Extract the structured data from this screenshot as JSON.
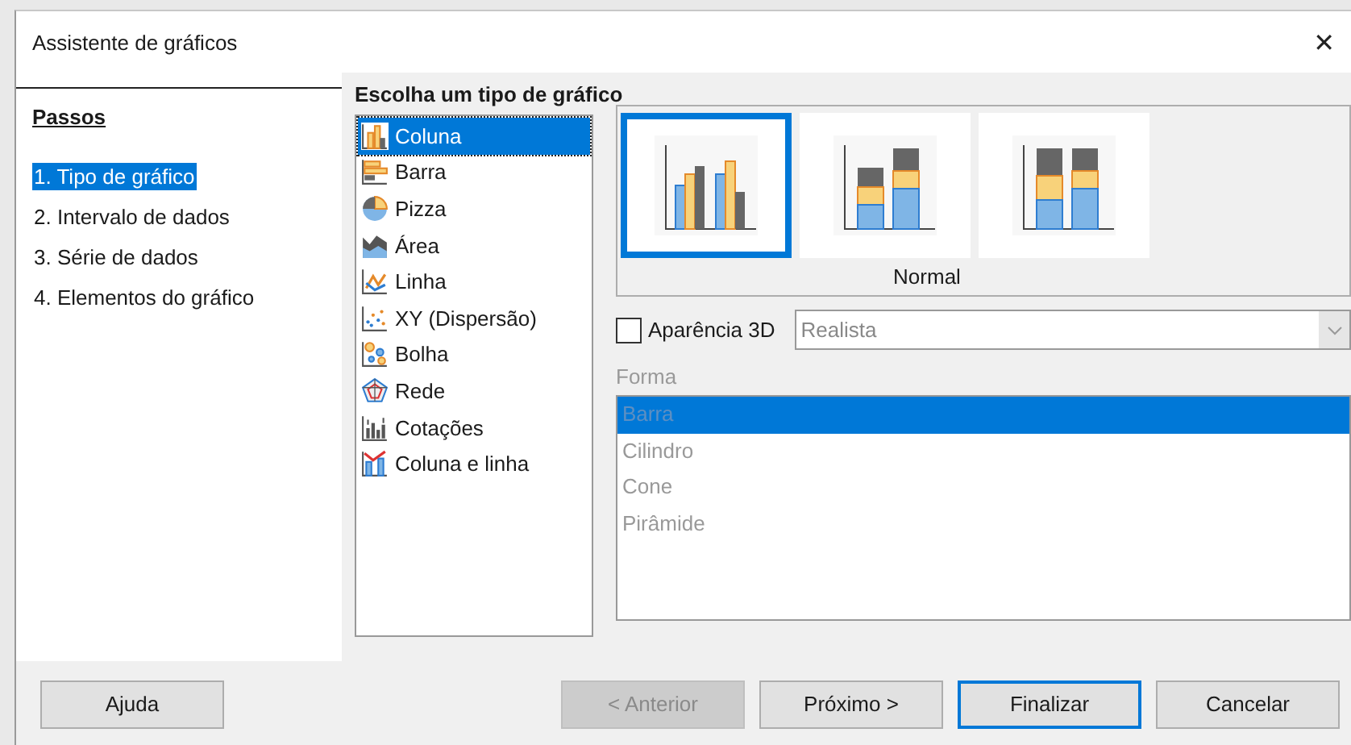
{
  "window": {
    "title": "Assistente de gráficos",
    "close": "✕"
  },
  "steps": {
    "heading": "Passos",
    "items": [
      {
        "label": "1. Tipo de gráfico",
        "selected": true
      },
      {
        "label": "2. Intervalo de dados",
        "selected": false
      },
      {
        "label": "3. Série de dados",
        "selected": false
      },
      {
        "label": "4. Elementos do gráfico",
        "selected": false
      }
    ]
  },
  "chart_type": {
    "heading": "Escolha um tipo de gráfico",
    "types": [
      {
        "label": "Coluna",
        "kind": "column",
        "selected": true
      },
      {
        "label": "Barra",
        "kind": "bar",
        "selected": false
      },
      {
        "label": "Pizza",
        "kind": "pie",
        "selected": false
      },
      {
        "label": "Área",
        "kind": "area",
        "selected": false
      },
      {
        "label": "Linha",
        "kind": "line",
        "selected": false
      },
      {
        "label": "XY (Dispersão)",
        "kind": "scatter",
        "selected": false
      },
      {
        "label": "Bolha",
        "kind": "bubble",
        "selected": false
      },
      {
        "label": "Rede",
        "kind": "net",
        "selected": false
      },
      {
        "label": "Cotações",
        "kind": "stock",
        "selected": false
      },
      {
        "label": "Coluna e linha",
        "kind": "columnline",
        "selected": false
      }
    ],
    "variants": [
      {
        "kind": "clustered",
        "selected": true
      },
      {
        "kind": "stacked",
        "selected": false
      },
      {
        "kind": "percent",
        "selected": false
      }
    ],
    "variant_label": "Normal"
  },
  "appearance_3d": {
    "label": "Aparência 3D",
    "checked": false,
    "dropdown": {
      "value": "Realista",
      "disabled": true
    }
  },
  "shape": {
    "label": "Forma",
    "disabled": true,
    "items": [
      {
        "label": "Barra",
        "selected": true
      },
      {
        "label": "Cilindro",
        "selected": false
      },
      {
        "label": "Cone",
        "selected": false
      },
      {
        "label": "Pirâmide",
        "selected": false
      }
    ]
  },
  "buttons": [
    {
      "label": "Ajuda",
      "kind": "help",
      "disabled": false,
      "default": false
    },
    {
      "label": "< Anterior",
      "kind": "nav",
      "disabled": true,
      "default": false
    },
    {
      "label": "Próximo >",
      "kind": "nav",
      "disabled": false,
      "default": false
    },
    {
      "label": "Finalizar",
      "kind": "nav",
      "disabled": false,
      "default": true
    },
    {
      "label": "Cancelar",
      "kind": "nav",
      "disabled": false,
      "default": false
    }
  ]
}
